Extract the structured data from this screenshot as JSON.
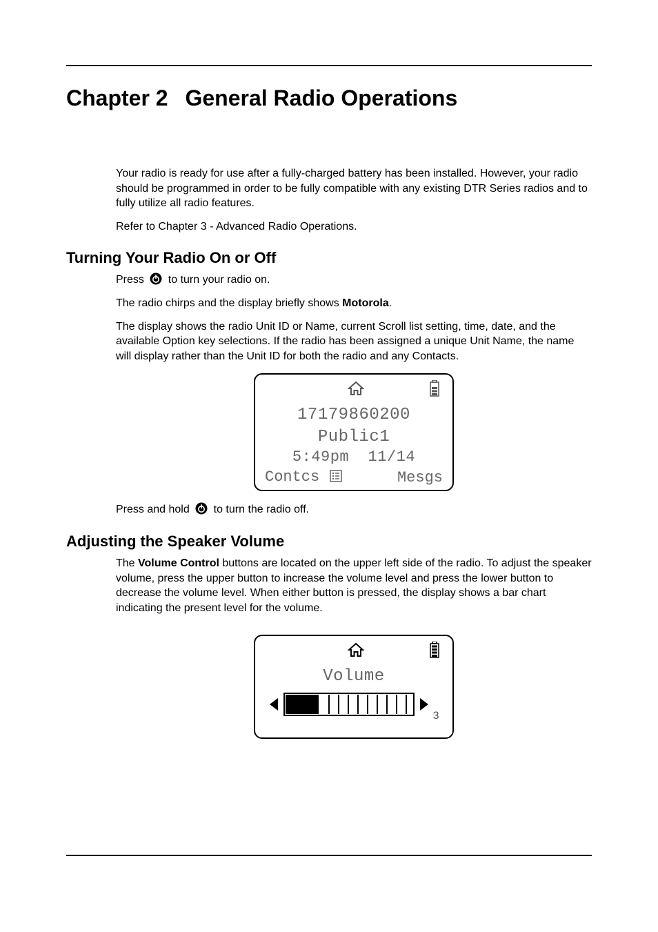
{
  "chapter": {
    "number": "Chapter 2",
    "title": "General Radio Operations"
  },
  "intro": {
    "p1": "Your radio is ready for use after a fully-charged battery has been installed. However, your radio should be programmed in order to be fully compatible with any existing DTR Series radios and to fully utilize all radio features.",
    "p2": "Refer to Chapter 3 - Advanced Radio Operations."
  },
  "section1": {
    "heading": "Turning Your Radio On or Off",
    "press_prefix": "Press ",
    "press_suffix": " to turn your radio on.",
    "chirps_prefix": "The radio chirps and the display briefly shows ",
    "motorola": "Motorola",
    "chirps_suffix": ".",
    "display_para": "The display shows the radio Unit ID or Name, current Scroll list setting, time, date, and the available Option key selections. If the radio has been assigned a unique Unit Name, the name will display rather than the Unit ID for both the radio and any Contacts.",
    "screen": {
      "unit_id": "17179860200",
      "scroll": "Public1",
      "time": "5:49pm",
      "date": "11/14",
      "left_key": "Contcs",
      "right_key": "Mesgs"
    },
    "hold_prefix": "Press and hold ",
    "hold_suffix": " to turn the radio off."
  },
  "section2": {
    "heading": "Adjusting the Speaker Volume",
    "para_a": "The ",
    "vc": "Volume Control",
    "para_b": " buttons are located on the upper left side of the radio. To adjust the speaker volume, press the upper button to increase the volume level and press the lower button to decrease the volume level. When either button is pressed, the display shows a bar chart indicating the present level for the volume.",
    "screen": {
      "label": "Volume",
      "level": "3"
    }
  }
}
